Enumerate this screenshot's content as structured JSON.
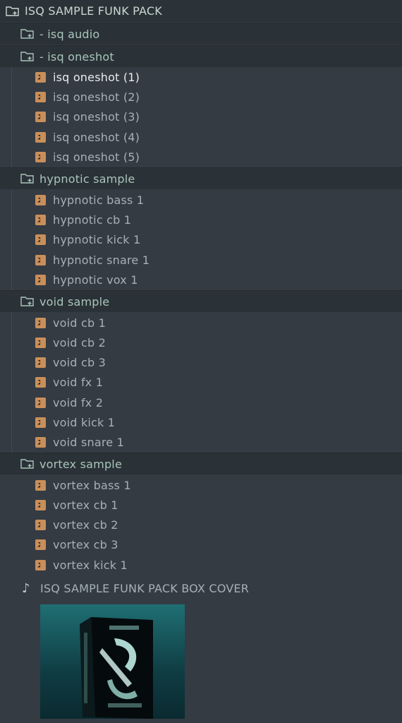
{
  "root": {
    "label": "ISQ SAMPLE FUNK PACK",
    "icon": "folder-plus-icon"
  },
  "folders": [
    {
      "label": "- isq audio",
      "files": []
    },
    {
      "label": "- isq oneshot",
      "files": [
        "isq oneshot (1)",
        "isq oneshot (2)",
        "isq oneshot (3)",
        "isq oneshot (4)",
        "isq oneshot (5)"
      ]
    },
    {
      "label": "hypnotic sample",
      "files": [
        "hypnotic bass 1",
        "hypnotic cb 1",
        "hypnotic kick 1",
        "hypnotic snare 1",
        "hypnotic vox 1"
      ]
    },
    {
      "label": "void sample",
      "files": [
        "void cb 1",
        "void cb 2",
        "void cb 3",
        "void fx 1",
        "void fx 2",
        "void kick 1",
        "void snare 1"
      ]
    },
    {
      "label": "vortex sample",
      "files": [
        "vortex bass 1",
        "vortex cb 1",
        "vortex cb 2",
        "vortex cb 3",
        "vortex kick 1"
      ]
    }
  ],
  "box_cover": {
    "label": "ISQ SAMPLE FUNK PACK BOX COVER",
    "icon": "music-note-icon"
  },
  "colors": {
    "background": "#343b43",
    "folder_row": "#2a3137",
    "folder_text": "#a9c5b9",
    "file_text": "#a6b0b8",
    "file_icon": "#c98f5a",
    "active_text": "#e8ecef"
  },
  "active_file": "isq oneshot (1)"
}
